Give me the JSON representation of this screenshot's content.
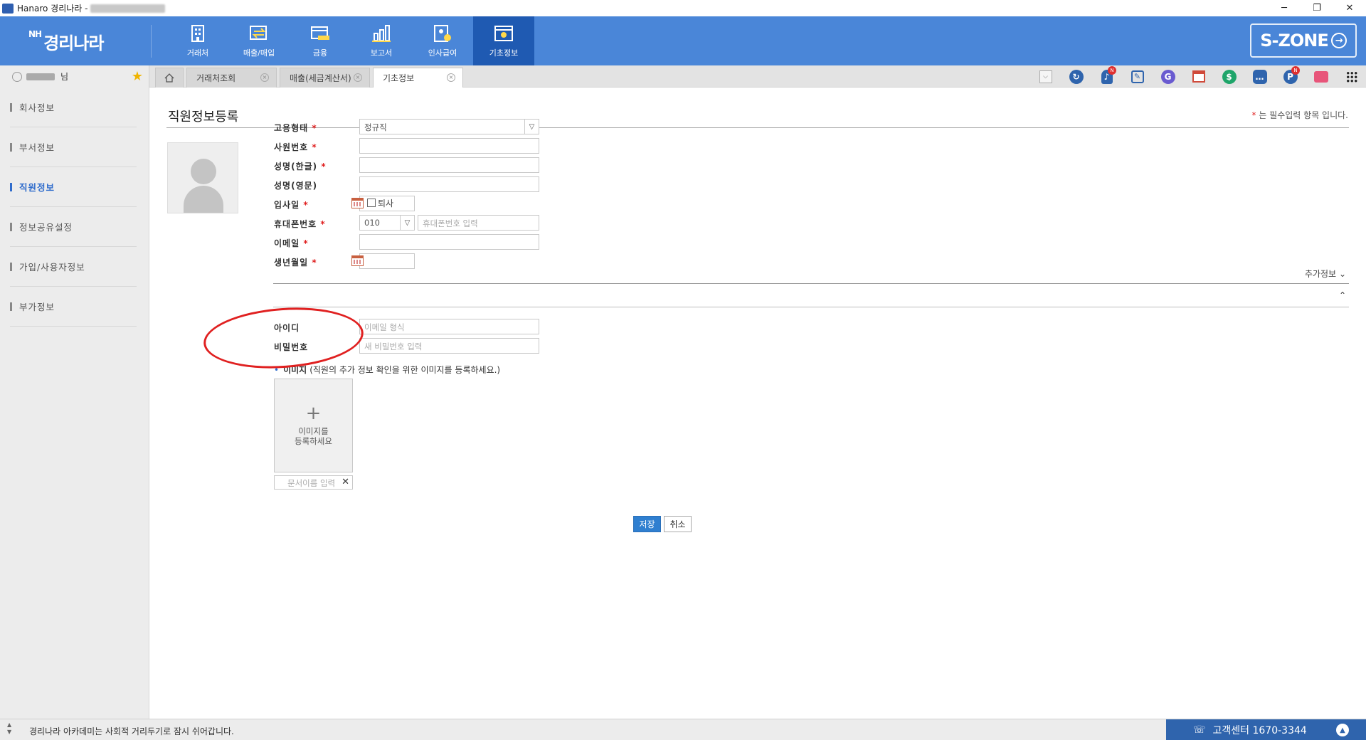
{
  "window": {
    "title": "Hanaro 경리나라 -",
    "controls": [
      "─",
      "❐",
      "✕"
    ]
  },
  "header": {
    "logo_prefix": "NH",
    "logo_text": "경리나라",
    "menu": [
      {
        "label": "거래처",
        "icon": "building-icon"
      },
      {
        "label": "매출/매입",
        "icon": "exchange-icon"
      },
      {
        "label": "금융",
        "icon": "card-icon"
      },
      {
        "label": "보고서",
        "icon": "bar-chart-icon"
      },
      {
        "label": "인사급여",
        "icon": "person-document-icon"
      },
      {
        "label": "기초정보",
        "icon": "settings-window-icon",
        "active": true
      }
    ],
    "szone_label": "S-ZONE",
    "szone_arrow": "→",
    "accent_color": "#4a86d8",
    "active_color": "#1f5ab2"
  },
  "user": {
    "suffix": "님"
  },
  "tabs": [
    {
      "label": "거래처조회",
      "close": "×"
    },
    {
      "label": "매출(세금계산서)",
      "close": "×"
    },
    {
      "label": "기초정보",
      "close": "×",
      "active": true
    }
  ],
  "toolbar_icons": [
    "dropdown-icon",
    "refresh-icon",
    "bell-icon",
    "edit-icon",
    "g-icon",
    "calendar-icon",
    "dollar-icon",
    "chat-icon",
    "p-icon",
    "card-icon",
    "apps-grid-icon"
  ],
  "toolbar_badge": "N",
  "sidebar": {
    "items": [
      {
        "label": "회사정보"
      },
      {
        "label": "부서정보"
      },
      {
        "label": "직원정보",
        "active": true
      },
      {
        "label": "정보공유설정"
      },
      {
        "label": "가입/사용자정보"
      },
      {
        "label": "부가정보"
      }
    ]
  },
  "page": {
    "title": "직원정보등록",
    "required_note": "는 필수입력 항목 입니다.",
    "required_mark": "*"
  },
  "form": {
    "employment_type": {
      "label": "고용형태",
      "value": "정규직"
    },
    "employee_no": {
      "label": "사원번호",
      "value": ""
    },
    "name_kr": {
      "label": "성명(한글)",
      "value": ""
    },
    "name_en": {
      "label": "성명(영문)",
      "value": ""
    },
    "join_date": {
      "label": "입사일",
      "value": "",
      "resigned_label": "퇴사"
    },
    "mobile": {
      "label": "휴대폰번호",
      "prefix": "010",
      "placeholder": "휴대폰번호 입력"
    },
    "email": {
      "label": "이메일",
      "value": ""
    },
    "birth": {
      "label": "생년월일",
      "value": ""
    },
    "more_info_label": "추가정보",
    "id": {
      "label": "아이디",
      "placeholder": "이메일 형식"
    },
    "password": {
      "label": "비밀번호",
      "placeholder": "새 비밀번호 입력"
    },
    "image_section": {
      "title": "이미지",
      "hint": "(직원의 추가 정보 확인을 위한 이미지를 등록하세요.)",
      "upload_plus": "+",
      "upload_line1": "이미지를",
      "upload_line2": "등록하세요",
      "docname_placeholder": "문서이름 입력",
      "docname_clear": "✕"
    }
  },
  "buttons": {
    "save": "저장",
    "cancel": "취소"
  },
  "statusbar": {
    "message": "경리나라 아카데미는 사회적 거리두기로 잠시 쉬어갑니다.",
    "call_center": "고객센터 1670-3344"
  }
}
